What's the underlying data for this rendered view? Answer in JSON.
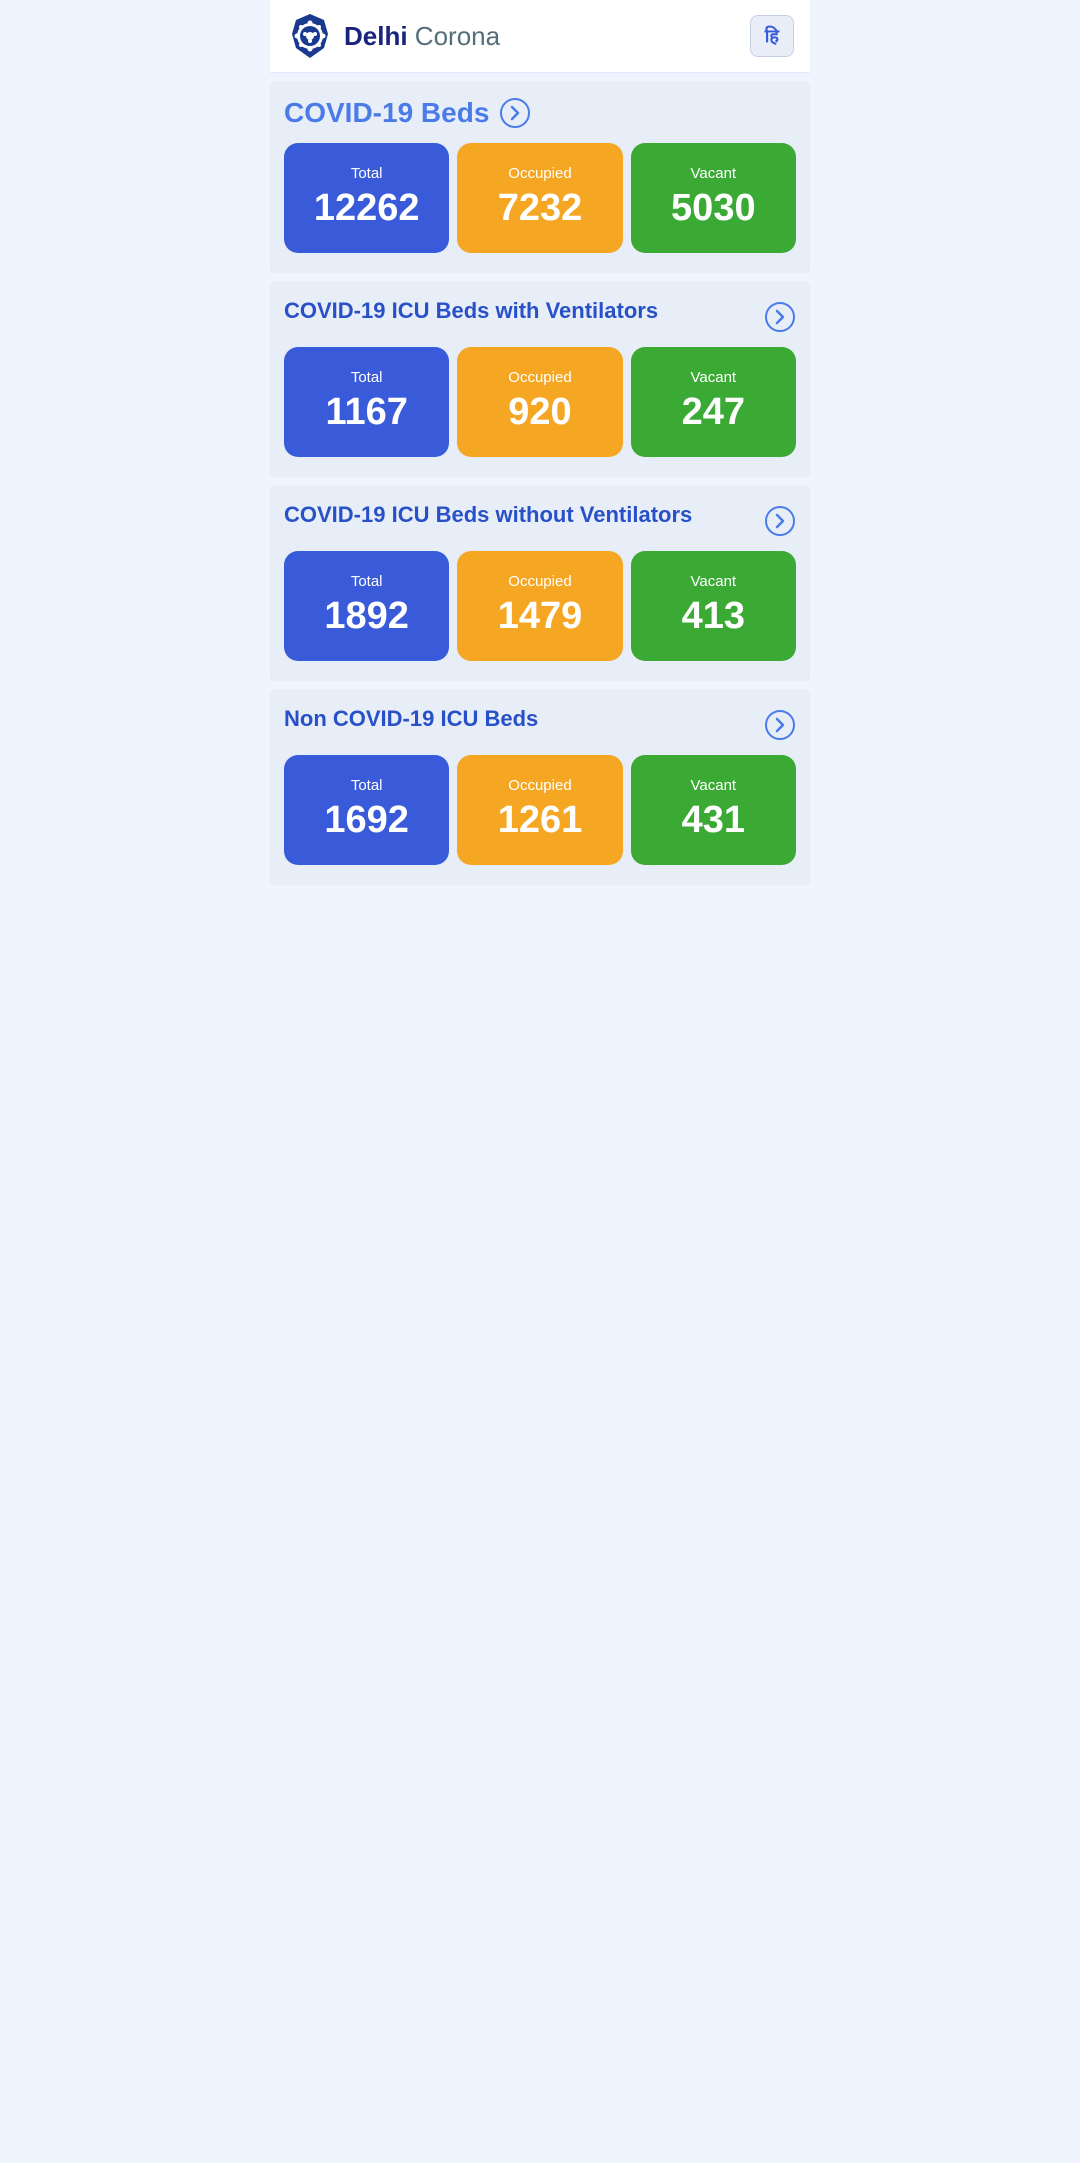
{
  "header": {
    "title_part1": "Delhi",
    "title_part2": " Corona",
    "lang_btn": "हि"
  },
  "page_title": "COVID-19 Beds",
  "sections": [
    {
      "id": "covid19-beds",
      "title": "COVID-19 Beds",
      "show_title_inline": true,
      "total_label": "Total",
      "total_value": "12262",
      "occupied_label": "Occupied",
      "occupied_value": "7232",
      "vacant_label": "Vacant",
      "vacant_value": "5030"
    },
    {
      "id": "icu-with-vent",
      "title": "COVID-19 ICU Beds with Ventilators",
      "total_label": "Total",
      "total_value": "1167",
      "occupied_label": "Occupied",
      "occupied_value": "920",
      "vacant_label": "Vacant",
      "vacant_value": "247"
    },
    {
      "id": "icu-without-vent",
      "title": "COVID-19 ICU Beds without Ventilators",
      "total_label": "Total",
      "total_value": "1892",
      "occupied_label": "Occupied",
      "occupied_value": "1479",
      "vacant_label": "Vacant",
      "vacant_value": "413"
    },
    {
      "id": "non-covid-icu",
      "title": "Non COVID-19 ICU Beds",
      "total_label": "Total",
      "total_value": "1692",
      "occupied_label": "Occupied",
      "occupied_value": "1261",
      "vacant_label": "Vacant",
      "vacant_value": "431"
    }
  ]
}
